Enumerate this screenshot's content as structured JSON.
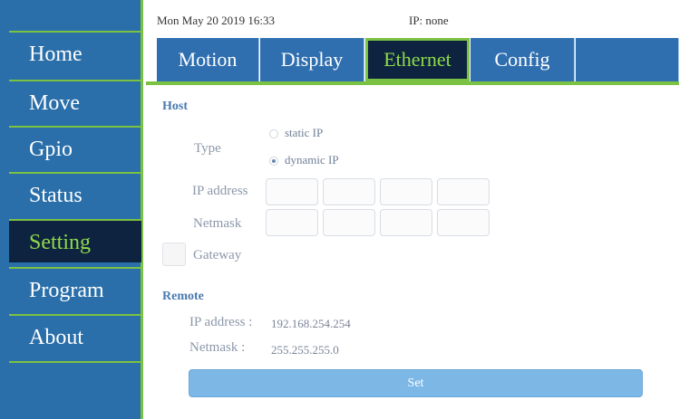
{
  "sidebar": {
    "items": [
      {
        "label": "Home"
      },
      {
        "label": "Move"
      },
      {
        "label": "Gpio"
      },
      {
        "label": "Status"
      },
      {
        "label": "Setting"
      },
      {
        "label": "Program"
      },
      {
        "label": "About"
      }
    ],
    "active": "Setting"
  },
  "status": {
    "datetime": "Mon May 20 2019 16:33",
    "ip": "IP: none"
  },
  "tabs": [
    {
      "label": "Motion"
    },
    {
      "label": "Display"
    },
    {
      "label": "Ethernet"
    },
    {
      "label": "Config"
    }
  ],
  "active_tab": "Ethernet",
  "host": {
    "title": "Host",
    "type_label": "Type",
    "options": [
      "static IP",
      "dynamic IP"
    ],
    "selected_option": "dynamic IP",
    "ip_label": "IP address",
    "netmask_label": "Netmask",
    "gateway_label": "Gateway"
  },
  "remote": {
    "title": "Remote",
    "ip_label": "IP address :",
    "ip_value": "192.168.254.254",
    "netmask_label": "Netmask :",
    "netmask_value": "255.255.255.0"
  },
  "set_button": "Set",
  "colors": {
    "sidebar": "#2a6fa9",
    "accent_green": "#7cc242",
    "active_bg": "#0d2340",
    "button": "#7db7e6"
  }
}
